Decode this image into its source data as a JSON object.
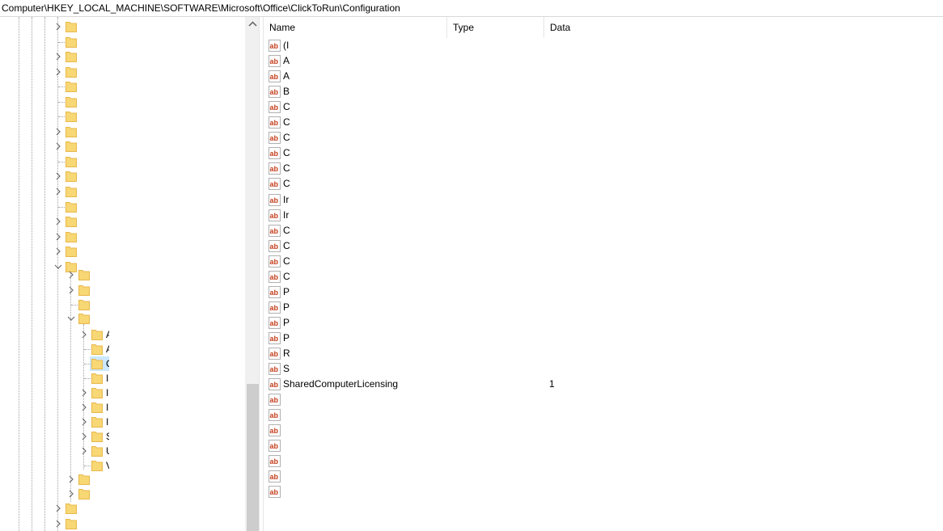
{
  "address": {
    "path": "Computer\\HKEY_LOCAL_MACHINE\\SOFTWARE\\Microsoft\\Office\\ClickToRun\\Configuration"
  },
  "tree": {
    "clipped_labels": [
      "A",
      "A",
      "C",
      "I",
      "I",
      "I",
      "I",
      "S",
      "U",
      "V"
    ]
  },
  "values": {
    "columns": {
      "name": "Name",
      "type": "Type",
      "data": "Data"
    },
    "rows": [
      {
        "name": "(I",
        "type": "",
        "data": ""
      },
      {
        "name": "A",
        "type": "",
        "data": ""
      },
      {
        "name": "A",
        "type": "",
        "data": ""
      },
      {
        "name": "B",
        "type": "",
        "data": ""
      },
      {
        "name": "C",
        "type": "",
        "data": ""
      },
      {
        "name": "C",
        "type": "",
        "data": ""
      },
      {
        "name": "C",
        "type": "",
        "data": ""
      },
      {
        "name": "C",
        "type": "",
        "data": ""
      },
      {
        "name": "C",
        "type": "",
        "data": ""
      },
      {
        "name": "C",
        "type": "",
        "data": ""
      },
      {
        "name": "Ir",
        "type": "",
        "data": ""
      },
      {
        "name": "Ir",
        "type": "",
        "data": ""
      },
      {
        "name": "C",
        "type": "",
        "data": ""
      },
      {
        "name": "C",
        "type": "",
        "data": ""
      },
      {
        "name": "C",
        "type": "",
        "data": ""
      },
      {
        "name": "C",
        "type": "",
        "data": ""
      },
      {
        "name": "P",
        "type": "",
        "data": ""
      },
      {
        "name": "P",
        "type": "",
        "data": ""
      },
      {
        "name": "P",
        "type": "",
        "data": ""
      },
      {
        "name": "P",
        "type": "",
        "data": ""
      },
      {
        "name": "R",
        "type": "",
        "data": ""
      },
      {
        "name": "S",
        "type": "",
        "data": ""
      },
      {
        "name": "SharedComputerLicensing",
        "type": "",
        "data": "1"
      },
      {
        "name": "",
        "type": "",
        "data": ""
      },
      {
        "name": "",
        "type": "",
        "data": ""
      },
      {
        "name": "",
        "type": "",
        "data": ""
      },
      {
        "name": "",
        "type": "",
        "data": ""
      },
      {
        "name": "",
        "type": "",
        "data": ""
      },
      {
        "name": "",
        "type": "",
        "data": ""
      },
      {
        "name": "",
        "type": "",
        "data": ""
      }
    ]
  },
  "colors": {
    "folder": "#f8d775",
    "folder_dark": "#e8b84a",
    "string_icon_red": "#c43e1c",
    "selection": "#cce8ff",
    "scroll_thumb": "#cdcdcd"
  }
}
